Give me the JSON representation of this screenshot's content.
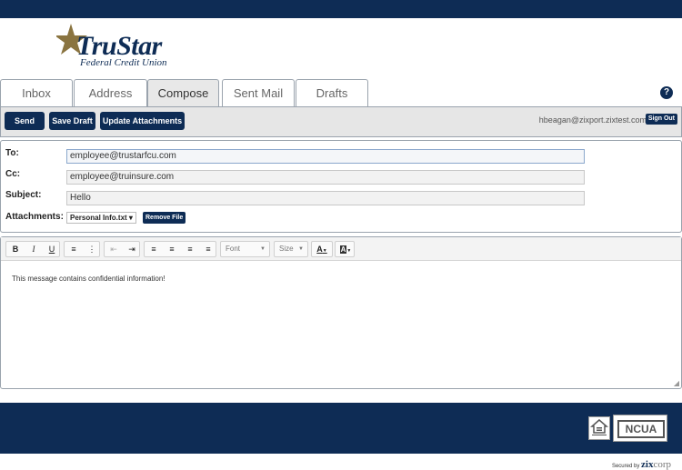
{
  "brand": {
    "name": "TruStar",
    "sub": "Federal Credit Union"
  },
  "tabs": [
    {
      "label": "Inbox"
    },
    {
      "label": "Address"
    },
    {
      "label": "Compose"
    },
    {
      "label": "Sent Mail"
    },
    {
      "label": "Drafts"
    }
  ],
  "active_tab": "Compose",
  "help_icon": "?",
  "toolbar": {
    "send_label": "Send",
    "save_draft_label": "Save Draft",
    "update_attachments_label": "Update Attachments",
    "user_email": "hbeagan@zixport.zixtest.com",
    "sign_out_label": "Sign Out"
  },
  "compose": {
    "to_label": "To:",
    "to_value": "employee@trustarfcu.com",
    "cc_label": "Cc:",
    "cc_value": "employee@truinsure.com",
    "subject_label": "Subject:",
    "subject_value": "Hello",
    "attachments_label": "Attachments:",
    "attachment_selected": "Personal Info.txt",
    "remove_file_label": "Remove File"
  },
  "editor": {
    "font_label": "Font",
    "size_label": "Size",
    "body": "This message contains confidential information!"
  },
  "footer": {
    "ncua_label": "NCUA",
    "secured_by": "Secured by",
    "zix": "zix",
    "corp": "corp"
  },
  "colors": {
    "navy": "#0e2c55",
    "star": "#8a7440"
  }
}
